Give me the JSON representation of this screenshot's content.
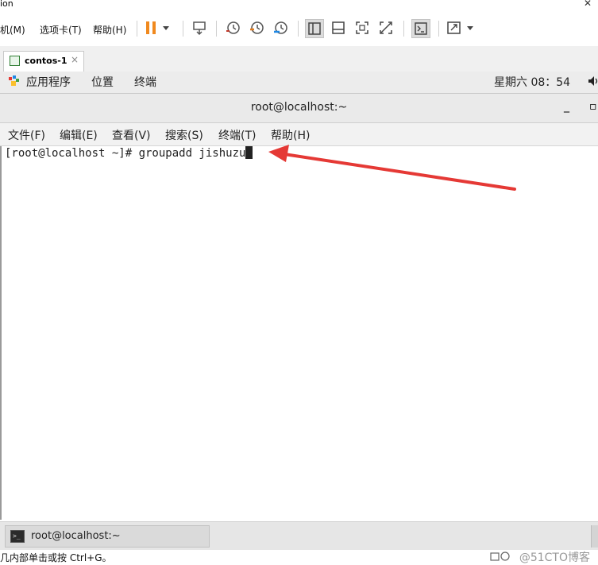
{
  "vmware": {
    "title_fragment": "ion",
    "menu": [
      {
        "label": "机(M)"
      },
      {
        "label": "选项卡(T)"
      },
      {
        "label": "帮助(H)"
      }
    ]
  },
  "tab": {
    "label": "contos-1",
    "close": "×"
  },
  "gnome": {
    "applications": "应用程序",
    "places": "位置",
    "terminal": "终端",
    "clock": "星期六 08：54"
  },
  "terminal": {
    "title": "root@localhost:~",
    "minimize": "_",
    "maximize": "▫",
    "menu": [
      {
        "label": "文件(F)"
      },
      {
        "label": "编辑(E)"
      },
      {
        "label": "查看(V)"
      },
      {
        "label": "搜索(S)"
      },
      {
        "label": "终端(T)"
      },
      {
        "label": "帮助(H)"
      }
    ],
    "prompt": "[root@localhost ~]# ",
    "command": "groupadd jishuzu"
  },
  "taskbar": {
    "item_label": "root@localhost:~"
  },
  "status": {
    "text": "几内部单击或按 Ctrl+G。",
    "watermark": "@51CTO博客"
  },
  "colors": {
    "arrow": "#e53935",
    "pause": "#f0891e"
  }
}
